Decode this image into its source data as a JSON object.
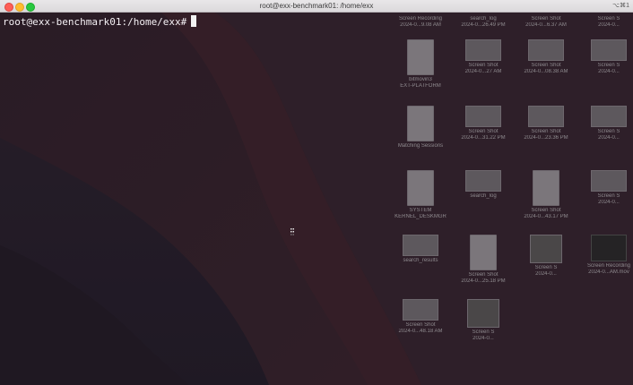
{
  "window": {
    "title": "root@exx-benchmark01: /home/exx",
    "shortcut": "⌥⌘1"
  },
  "terminal": {
    "prompt": "root@exx-benchmark01:/home/exx#"
  },
  "colors": {
    "background": "#1a1418",
    "text": "#f4f0f4",
    "close": "#fe5f57",
    "minimize": "#febc2e",
    "maximize": "#28c840"
  },
  "desktop": {
    "items": [
      {
        "line1": "Screen Recording",
        "line2": "2024-0...9.08 AM",
        "kind": "dark"
      },
      {
        "line1": "search_log",
        "line2": "2024-0...26.49 PM",
        "kind": "doc"
      },
      {
        "line1": "Screen Shot",
        "line2": "2024-0...6.37 AM",
        "kind": "screen"
      },
      {
        "line1": "Screen S",
        "line2": "2024-0...",
        "kind": "screen"
      },
      {
        "line1": "bitmovin3",
        "line2": "EXT-PLATFORM",
        "kind": "doc"
      },
      {
        "line1": "Screen Shot",
        "line2": "2024-0...27 AM",
        "kind": "screen"
      },
      {
        "line1": "Screen Shot",
        "line2": "2024-0...08.38 AM",
        "kind": "screen"
      },
      {
        "line1": "Screen S",
        "line2": "2024-0...",
        "kind": "screen"
      },
      {
        "line1": "Matching Sessions",
        "line2": "",
        "kind": "doc"
      },
      {
        "line1": "Screen Shot",
        "line2": "2024-0...31.22 PM",
        "kind": "screen"
      },
      {
        "line1": "Screen Shot",
        "line2": "2024-0...23.36 PM",
        "kind": "screen"
      },
      {
        "line1": "Screen S",
        "line2": "2024-0...",
        "kind": "screen"
      },
      {
        "line1": "SYSTEM",
        "line2": "KERNEL_DESKMGR",
        "kind": "doc"
      },
      {
        "line1": "search_log",
        "line2": "",
        "kind": "screen"
      },
      {
        "line1": "Screen Shot",
        "line2": "2024-0...43.17 PM",
        "kind": "doc"
      },
      {
        "line1": "Screen S",
        "line2": "2024-0...",
        "kind": "screen"
      },
      {
        "line1": "search_results",
        "line2": "",
        "kind": "screen"
      },
      {
        "line1": "Screen Shot",
        "line2": "2024-0...25.18 PM",
        "kind": "doc"
      },
      {
        "line1": "Screen S",
        "line2": "2024-0...",
        "kind": "photo"
      },
      {
        "line1": "Screen Recording",
        "line2": "2024-0...AM.mov",
        "kind": "dark"
      },
      {
        "line1": "Screen Shot",
        "line2": "2024-0...48.18 AM",
        "kind": "screen"
      },
      {
        "line1": "Screen S",
        "line2": "2024-0...",
        "kind": "photo"
      }
    ]
  }
}
